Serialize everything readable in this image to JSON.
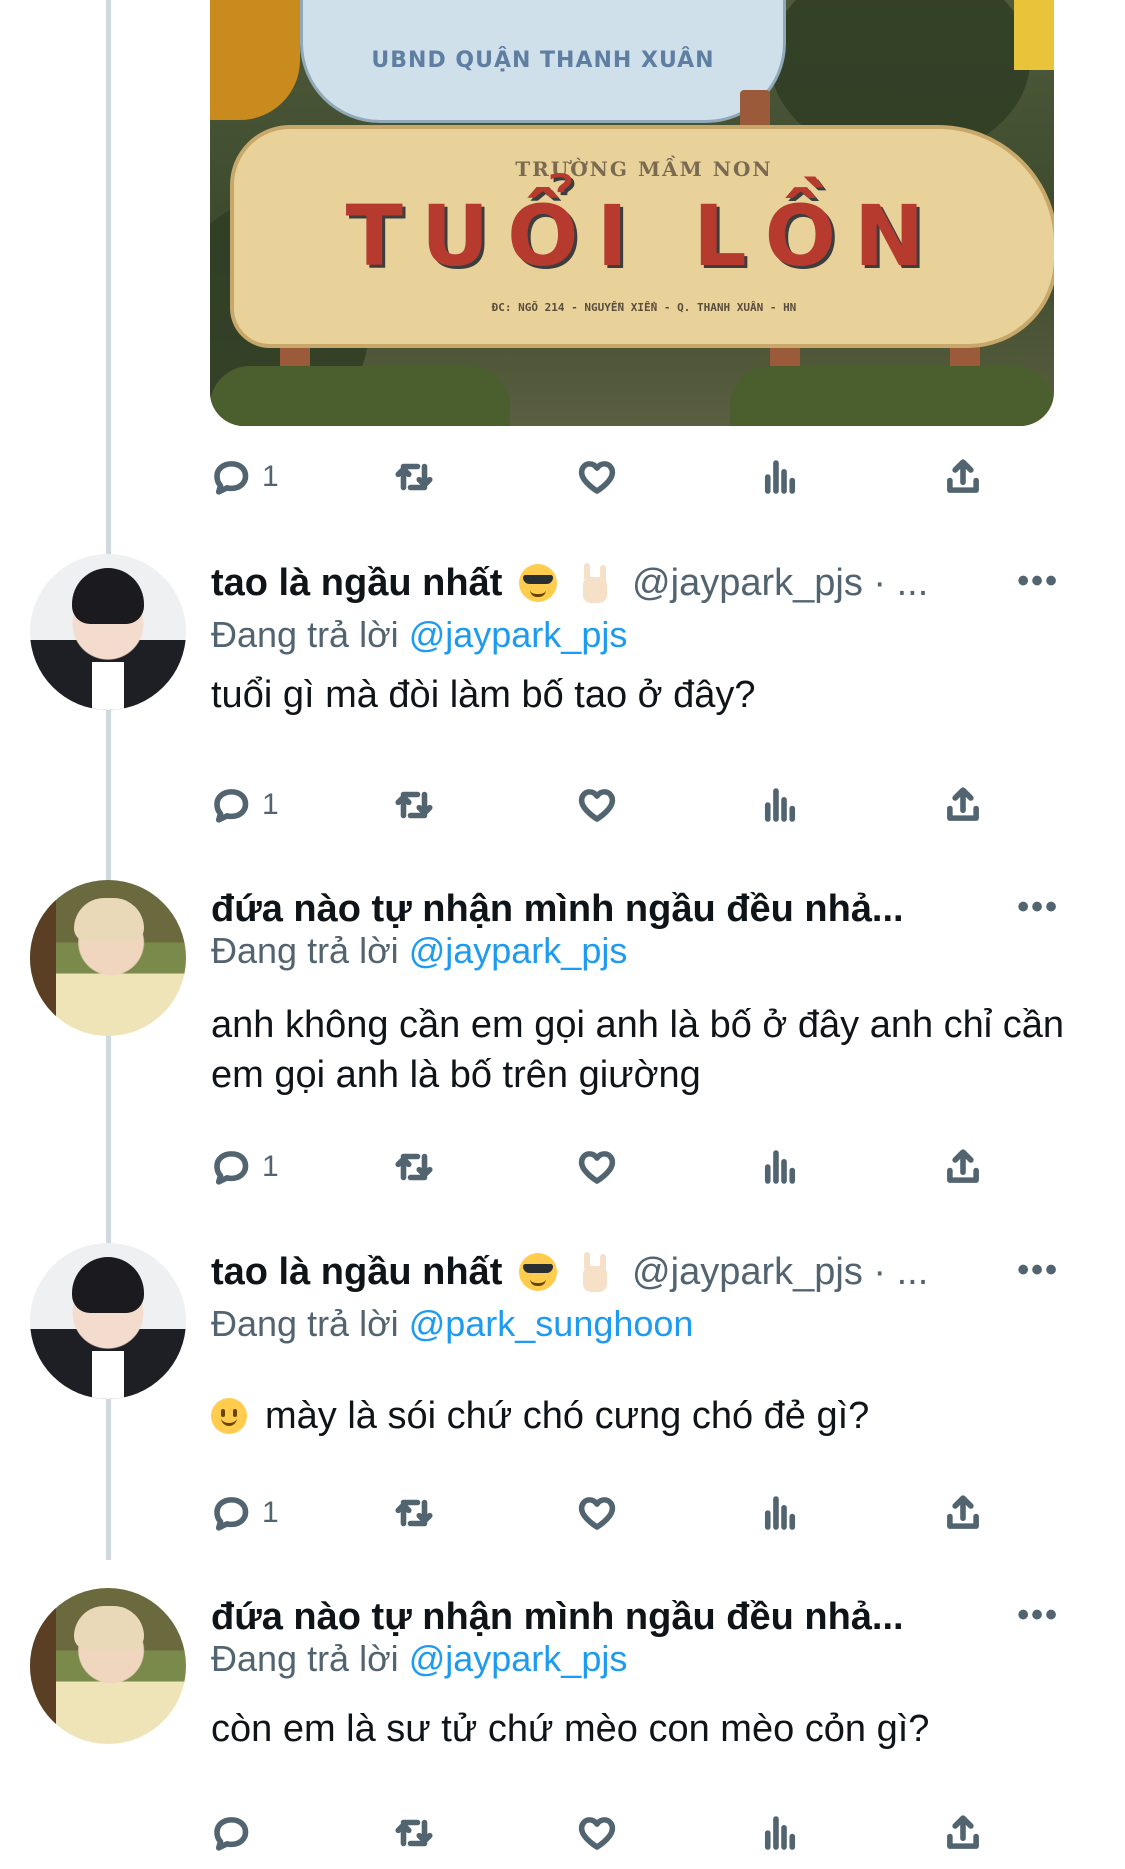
{
  "media": {
    "cloud_text": "UBND QUẬN THANH XUÂN",
    "board_subtitle": "TRƯỜNG MẦM NON",
    "board_title": "TUỔI LỒN",
    "board_address": "ĐC: NGÕ 214 - NGUYỄN XIỂN - Q. THANH XUÂN - HN"
  },
  "top_actions": {
    "reply_count": "1"
  },
  "tweets": [
    {
      "name": "tao là ngầu nhất",
      "handle": "@jaypark_pjs · ...",
      "replying_label": "Đang trả lời",
      "replying_to": "@jaypark_pjs",
      "text": "tuổi gì mà đòi làm bố tao ở đây?",
      "reply_count": "1"
    },
    {
      "name": "đứa nào tự nhận mình ngầu đều nhả...",
      "handle": "",
      "replying_label": "Đang trả lời",
      "replying_to": "@jaypark_pjs",
      "text": "anh không cần em gọi anh là bố ở đây anh chỉ cần em gọi anh là bố trên giường",
      "reply_count": "1"
    },
    {
      "name": "tao là ngầu nhất",
      "handle": "@jaypark_pjs · ...",
      "replying_label": "Đang trả lời",
      "replying_to": "@park_sunghoon",
      "text": "mày là sói chứ chó cưng chó đẻ gì?",
      "reply_count": "1"
    },
    {
      "name": "đứa nào tự nhận mình ngầu đều nhả...",
      "handle": "",
      "replying_label": "Đang trả lời",
      "replying_to": "@jaypark_pjs",
      "text": "còn em là sư tử chứ mèo con mèo cỏn gì?",
      "reply_count": ""
    }
  ],
  "more_label": "•••",
  "icons": [
    "reply-icon",
    "retweet-icon",
    "like-icon",
    "views-icon",
    "share-icon",
    "more-icon",
    "sunglasses-emoji",
    "rock-hand-emoji",
    "slight-smile-emoji"
  ],
  "colors": {
    "link": "#1d9bf0",
    "secondary": "#536471",
    "text": "#0f1419",
    "thread_line": "#cfd9de"
  }
}
